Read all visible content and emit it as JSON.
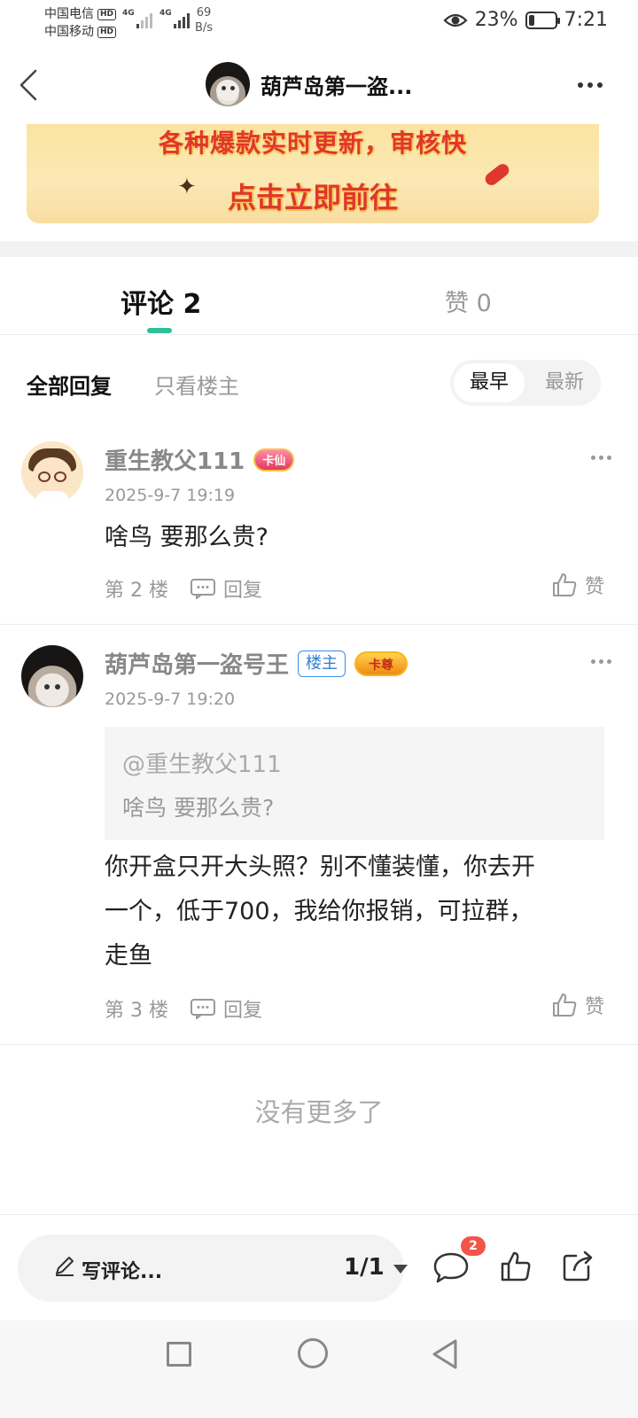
{
  "status_bar": {
    "carrier1": "中国电信",
    "carrier2": "中国移动",
    "hd": "HD",
    "network1": "4G",
    "network2": "4G",
    "speed_value": "69",
    "speed_unit": "B/s",
    "battery_percent": "23%",
    "battery_level": 0.23,
    "time": "7:21"
  },
  "header": {
    "title": "葫芦岛第一盗..."
  },
  "banner": {
    "line1": "各种爆款实时更新，审核快",
    "line2": "点击立即前往"
  },
  "tabs": {
    "comments": "评论 2",
    "likes": "赞 0"
  },
  "filters": {
    "all_replies": "全部回复",
    "owner_only": "只看楼主",
    "sort_earliest": "最早",
    "sort_newest": "最新"
  },
  "comments": [
    {
      "username": "重生教父111",
      "badge": "卡仙",
      "time": "2025-9-7 19:19",
      "text": "啥鸟 要那么贵?",
      "floor": "第 2 楼",
      "reply_label": "回复",
      "like_label": "赞"
    },
    {
      "username": "葫芦岛第一盗号王",
      "owner_badge": "楼主",
      "badge": "卡尊",
      "time": "2025-9-7 19:20",
      "quote_user": "@重生教父111",
      "quote_text": "啥鸟 要那么贵?",
      "text_line1": "你开盒只开大头照？别不懂装懂，你去开",
      "text_line2": "一个，低于700，我给你报销，可拉群，",
      "text_line3": "走鱼",
      "floor": "第 3 楼",
      "reply_label": "回复",
      "like_label": "赞"
    }
  ],
  "no_more": "没有更多了",
  "bottom_bar": {
    "write_comment": "写评论...",
    "page_indicator": "1/1",
    "comment_count_badge": "2"
  },
  "colors": {
    "accent": "#2ebf9c",
    "banner_text": "#e0372b",
    "notif": "#f2544a"
  }
}
